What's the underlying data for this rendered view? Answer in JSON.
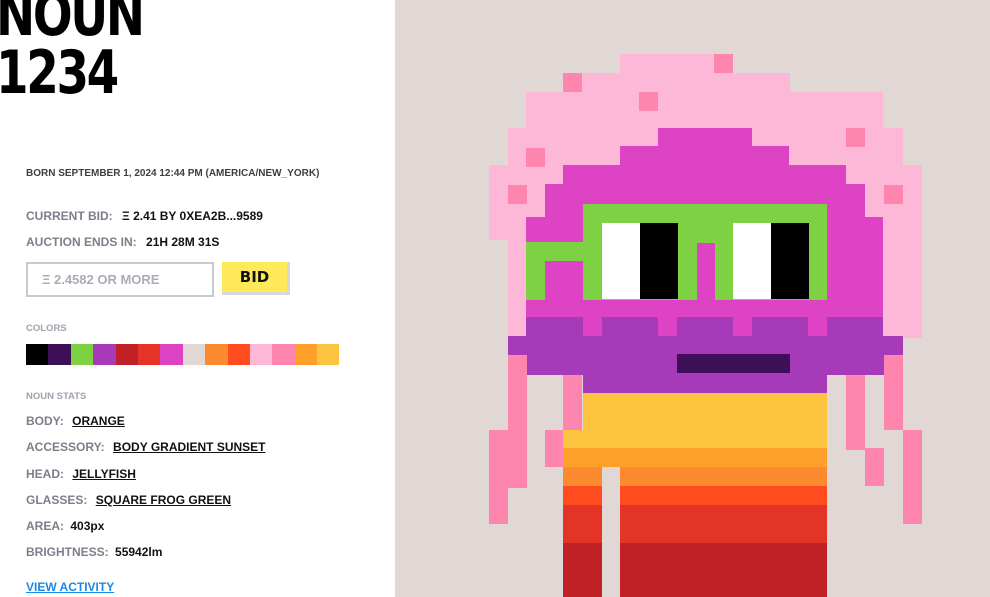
{
  "noun": {
    "title_line1": "NOUN",
    "title_line2": "1234"
  },
  "born": "BORN SEPTEMBER 1, 2024 12:44 PM (AMERICA/NEW_YORK)",
  "auction": {
    "current_bid_label": "CURRENT BID:",
    "current_bid_value": "Ξ 2.41 BY 0XEA2B...9589",
    "ends_label": "AUCTION ENDS IN:",
    "ends_value": "21H 28M 31S",
    "bid_placeholder": "Ξ 2.4582 OR MORE",
    "bid_button": "BID"
  },
  "colors_label": "COLORS",
  "colors": [
    "#000000",
    "#3d0f57",
    "#7dd142",
    "#a63ab8",
    "#c02126",
    "#e43327",
    "#de42c5",
    "#e1d7d5",
    "#fb8b2e",
    "#fe4c1f",
    "#fdb8d8",
    "#fe85ad",
    "#fea029",
    "#fdc43f"
  ],
  "stats_label": "NOUN STATS",
  "stats": {
    "body_label": "BODY:",
    "body_value": "ORANGE",
    "accessory_label": "ACCESSORY:",
    "accessory_value": "BODY GRADIENT SUNSET",
    "head_label": "HEAD:",
    "head_value": "JELLYFISH",
    "glasses_label": "GLASSES:",
    "glasses_value": "SQUARE FROG GREEN",
    "area_label": "AREA:",
    "area_value": "403px",
    "brightness_label": "BRIGHTNESS:",
    "brightness_value": "55942lm"
  },
  "view_activity": "VIEW ACTIVITY",
  "image": {
    "background_color": "#e1d7d5",
    "subject": "noun-pixel-art-icon"
  }
}
